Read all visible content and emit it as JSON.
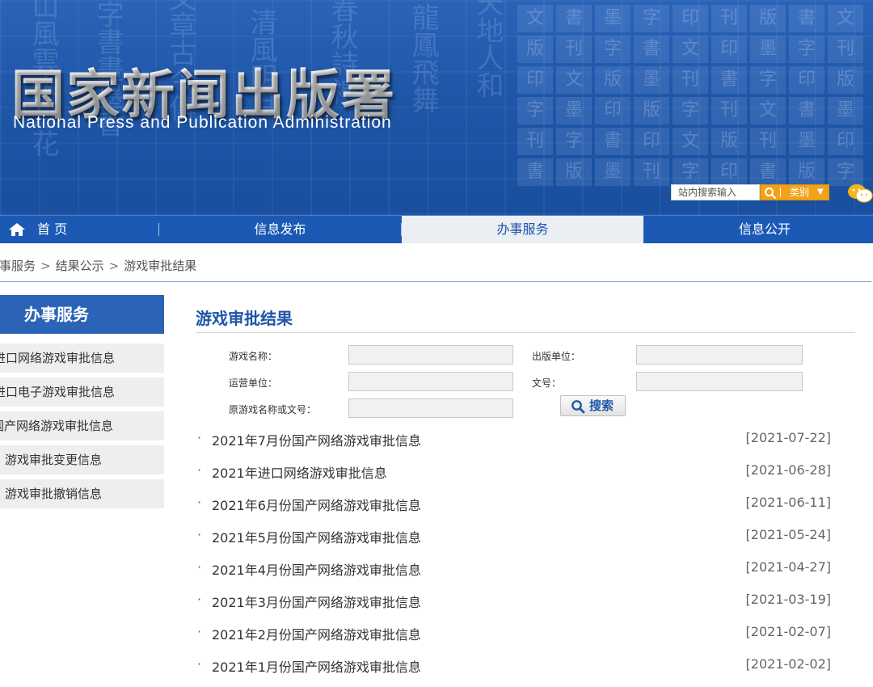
{
  "header": {
    "title_cn": "国家新闻出版署",
    "title_en": "National  Press and Publication Administration",
    "search_placeholder": "站内搜索输入",
    "category_label": "类别",
    "category_caret": "▼"
  },
  "nav": {
    "items": [
      {
        "label": "首 页"
      },
      {
        "label": "信息发布"
      },
      {
        "label": "办事服务"
      },
      {
        "label": "信息公开"
      }
    ],
    "active_index": 2
  },
  "breadcrumb": {
    "items": [
      "办事服务",
      "结果公示",
      "游戏审批结果"
    ],
    "separator": ">"
  },
  "sidebar": {
    "heading": "办事服务",
    "items": [
      {
        "label": "进口网络游戏审批信息"
      },
      {
        "label": "进口电子游戏审批信息"
      },
      {
        "label": "国产网络游戏审批信息"
      },
      {
        "label": "游戏审批变更信息"
      },
      {
        "label": "游戏审批撤销信息"
      }
    ]
  },
  "main": {
    "title": "游戏审批结果",
    "form": {
      "game_name_label": "游戏名称：",
      "publisher_label": "出版单位：",
      "operator_label": "运营单位：",
      "doc_no_label": "文号：",
      "original_label": "原游戏名称或文号：",
      "search_button": "搜索"
    },
    "list": [
      {
        "title": "2021年7月份国产网络游戏审批信息",
        "date": "[2021-07-22]"
      },
      {
        "title": "2021年进口网络游戏审批信息",
        "date": "[2021-06-28]"
      },
      {
        "title": "2021年6月份国产网络游戏审批信息",
        "date": "[2021-06-11]"
      },
      {
        "title": "2021年5月份国产网络游戏审批信息",
        "date": "[2021-05-24]"
      },
      {
        "title": "2021年4月份国产网络游戏审批信息",
        "date": "[2021-04-27]"
      },
      {
        "title": "2021年3月份国产网络游戏审批信息",
        "date": "[2021-03-19]"
      },
      {
        "title": "2021年2月份国产网络游戏审批信息",
        "date": "[2021-02-07]"
      },
      {
        "title": "2021年1月份国产网络游戏审批信息",
        "date": "[2021-02-02]"
      }
    ],
    "bullet": "·"
  },
  "colors": {
    "header_blue": "#1f56a8",
    "nav_blue": "#1c59b4",
    "accent_orange": "#f0a21a",
    "title_blue": "#1f56a8"
  },
  "icons": [
    "home-icon",
    "search-icon",
    "wechat-icon",
    "chevron-down-icon"
  ]
}
